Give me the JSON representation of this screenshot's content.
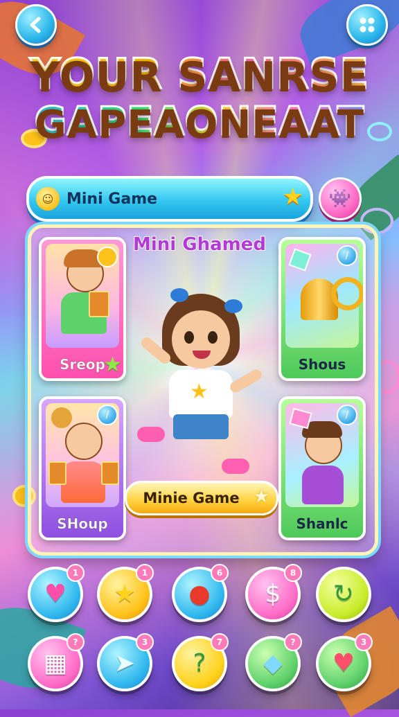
{
  "title": {
    "line1": "YOUR SANRSE",
    "line2": "GAPEAONEAAT"
  },
  "banner": {
    "label": "Mini Game"
  },
  "panel": {
    "title": "Mini Ghamed",
    "cards": [
      {
        "label": "Sreop"
      },
      {
        "label": "Shous"
      },
      {
        "label": "SHoup"
      },
      {
        "label": "Shanlc"
      }
    ],
    "center_button": "Minie Game"
  },
  "bottom_icons": {
    "row1": [
      {
        "icon": "heart-icon",
        "glyph": "♥",
        "count": "1"
      },
      {
        "icon": "star-face-icon",
        "glyph": "★",
        "count": "1"
      },
      {
        "icon": "tomato-icon",
        "glyph": "●",
        "count": "6"
      },
      {
        "icon": "dollar-icon",
        "glyph": "$",
        "count": "8"
      },
      {
        "icon": "swirl-icon",
        "glyph": "↻",
        "count": ""
      }
    ],
    "row2": [
      {
        "icon": "calendar-icon",
        "glyph": "▦",
        "count": "?"
      },
      {
        "icon": "paper-plane-icon",
        "glyph": "➤",
        "count": "3"
      },
      {
        "icon": "question-icon",
        "glyph": "?",
        "count": "7"
      },
      {
        "icon": "crystal-icon",
        "glyph": "◆",
        "count": "?"
      },
      {
        "icon": "apple-icon",
        "glyph": "♥",
        "count": "3"
      }
    ]
  },
  "colors": {
    "accent_blue": "#2ab6ea",
    "accent_pink": "#ff6cc8",
    "accent_yellow": "#ffd23e",
    "panel_title": "#b23ad6"
  }
}
